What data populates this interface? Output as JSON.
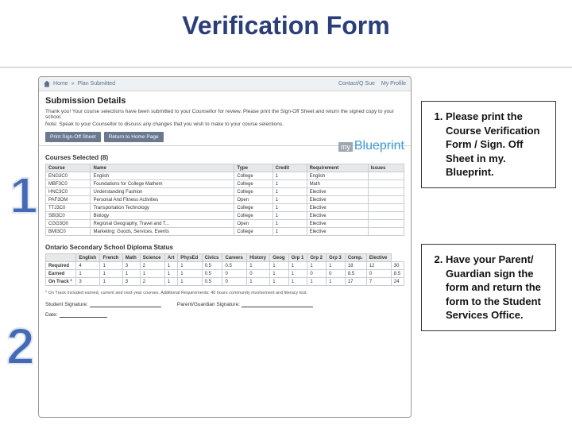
{
  "title": "Verification Form",
  "callouts": {
    "one": "Please print the Course Verification Form / Sign. Off Sheet in my. Blueprint.",
    "two": "Have your Parent/ Guardian sign the form and return the form to the Student Services Office."
  },
  "big_numbers": {
    "one": "1",
    "two": "2"
  },
  "screenshot": {
    "topbar": {
      "breadcrumb_home": "Home",
      "breadcrumb_sep": "»",
      "breadcrumb_current": "Plan Submitted",
      "contact": "Contact/Q Sue",
      "profile": "My Profile"
    },
    "submission": {
      "heading": "Submission Details",
      "p1": "Thank you! Your course selections have been submitted to your Counsellor for review. Please print the Sign-Off Sheet and return the signed copy to your school.",
      "p2": "Note: Speak to your Counsellor to discuss any changes that you wish to make to your course selections.",
      "btn_print": "Print Sign-Off Sheet",
      "btn_return": "Return to Home Page"
    },
    "logo": {
      "my": "my",
      "blueprint": "Blueprint"
    },
    "courses": {
      "heading": "Courses Selected (8)",
      "headers": [
        "Course",
        "Name",
        "Type",
        "Credit",
        "Requirement",
        "Issues"
      ],
      "rows": [
        [
          "ENG3C0",
          "English",
          "College",
          "1",
          "English",
          ""
        ],
        [
          "MBF3C0",
          "Foundations for College Mathem",
          "College",
          "1",
          "Math",
          ""
        ],
        [
          "HNC3C0",
          "Understanding Fashion",
          "College",
          "1",
          "Elective",
          ""
        ],
        [
          "PAF3OM",
          "Personal And Fitness Activities",
          "Open",
          "1",
          "Elective",
          ""
        ],
        [
          "TTJ3C0",
          "Transportation Technology",
          "College",
          "1",
          "Elective",
          ""
        ],
        [
          "SBI3C0",
          "Biology",
          "College",
          "1",
          "Elective",
          ""
        ],
        [
          "CGG3O0",
          "Regional Geography, Travel and T...",
          "Open",
          "1",
          "Elective",
          ""
        ],
        [
          "BMI3C0",
          "Marketing: Goods, Services, Events",
          "College",
          "1",
          "Elective",
          ""
        ]
      ]
    },
    "diploma": {
      "heading": "Ontario Secondary School Diploma Status",
      "headers": [
        "",
        "English",
        "French",
        "Math",
        "Science",
        "Art",
        "PhysEd",
        "Civics",
        "Careers",
        "History",
        "Geog",
        "Grp 1",
        "Grp 2",
        "Grp 3",
        "Comp.",
        "Elective"
      ],
      "rows": [
        [
          "Required",
          "4",
          "1",
          "3",
          "2",
          "1",
          "1",
          "0.5",
          "0.5",
          "1",
          "1",
          "1",
          "1",
          "1",
          "18",
          "12",
          "30"
        ],
        [
          "Earned",
          "1",
          "1",
          "1",
          "1",
          "1",
          "1",
          "0.5",
          "0",
          "0",
          "1",
          "1",
          "0",
          "0",
          "8.5",
          "0",
          "8.5"
        ],
        [
          "On Track *",
          "3",
          "1",
          "3",
          "2",
          "1",
          "1",
          "0.5",
          "0",
          "1",
          "1",
          "1",
          "1",
          "1",
          "17",
          "7",
          "24"
        ]
      ]
    },
    "footnote": "* On Track included earned, current and next year courses. Additional Requirements: 40 hours community involvement and literacy test.",
    "signatures": {
      "student": "Student Signature:",
      "parent": "Parent/Guardian Signature:",
      "date": "Date:"
    }
  }
}
